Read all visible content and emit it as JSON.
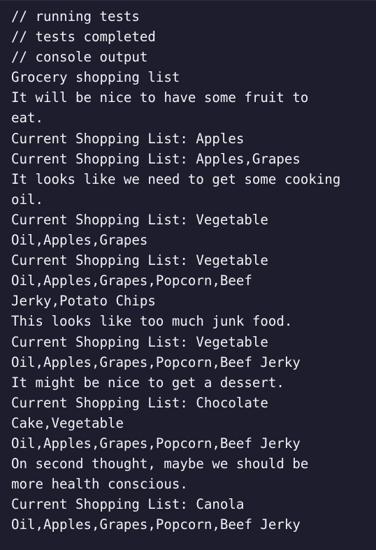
{
  "console": {
    "lines": [
      "// running tests",
      "// tests completed",
      "// console output",
      "Grocery shopping list",
      "It will be nice to have some fruit to",
      "eat.",
      "Current Shopping List: Apples",
      "Current Shopping List: Apples,Grapes",
      "It looks like we need to get some cooking",
      "oil.",
      "Current Shopping List: Vegetable",
      "Oil,Apples,Grapes",
      "Current Shopping List: Vegetable",
      "Oil,Apples,Grapes,Popcorn,Beef",
      "Jerky,Potato Chips",
      "This looks like too much junk food.",
      "Current Shopping List: Vegetable",
      "Oil,Apples,Grapes,Popcorn,Beef Jerky",
      "It might be nice to get a dessert.",
      "Current Shopping List: Chocolate",
      "Cake,Vegetable",
      "Oil,Apples,Grapes,Popcorn,Beef Jerky",
      "On second thought, maybe we should be",
      "more health conscious.",
      "Current Shopping List: Canola",
      "Oil,Apples,Grapes,Popcorn,Beef Jerky"
    ]
  }
}
